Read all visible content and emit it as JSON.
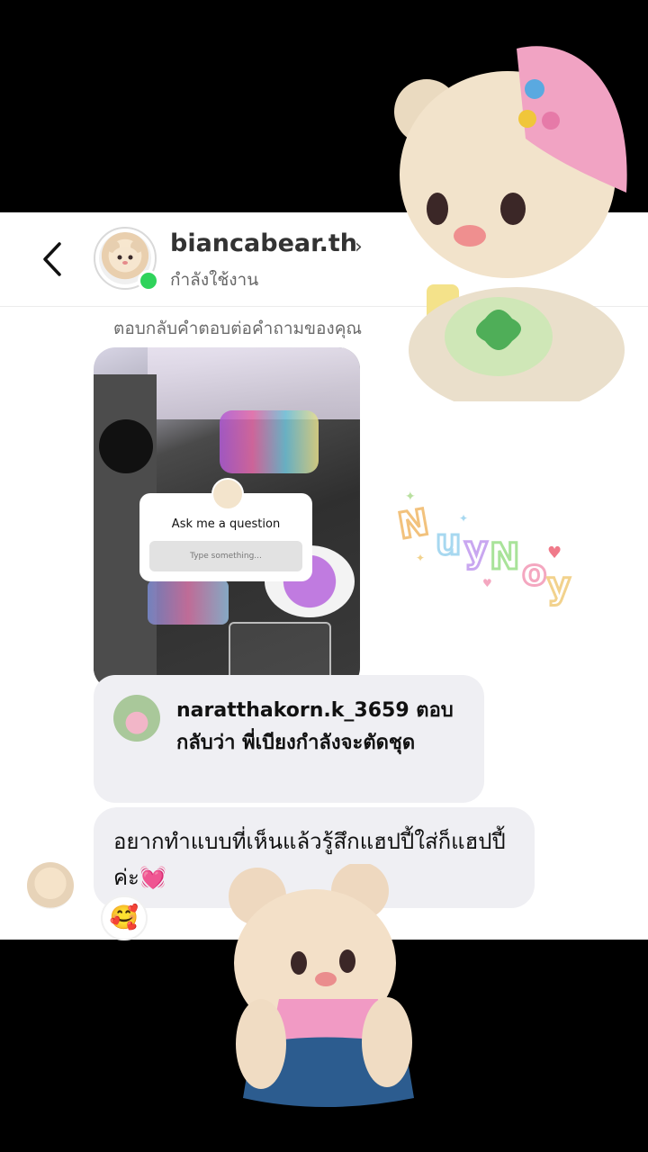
{
  "header": {
    "username": "biancabear.th",
    "status": "กำลังใช้งาน",
    "chevron": "›"
  },
  "thread": {
    "reply_note": "ตอบกลับคำตอบต่อคำถามของคุณ",
    "story": {
      "question_title": "Ask me a question",
      "input_placeholder": "Type something..."
    },
    "quoted_reply": "naratthakorn.k_3659 ตอบกลับว่า พี่เบียงกำลังจะตัดชุด",
    "message": "อยากทำแบบที่เห็นแล้วรู้สึกแฮปปี้ใส่ก็แฮปปี้ค่ะ💓",
    "reaction": "🥰"
  },
  "decor": {
    "sticker_text": "NuyNoy",
    "accent_online": "#2fd35b"
  }
}
